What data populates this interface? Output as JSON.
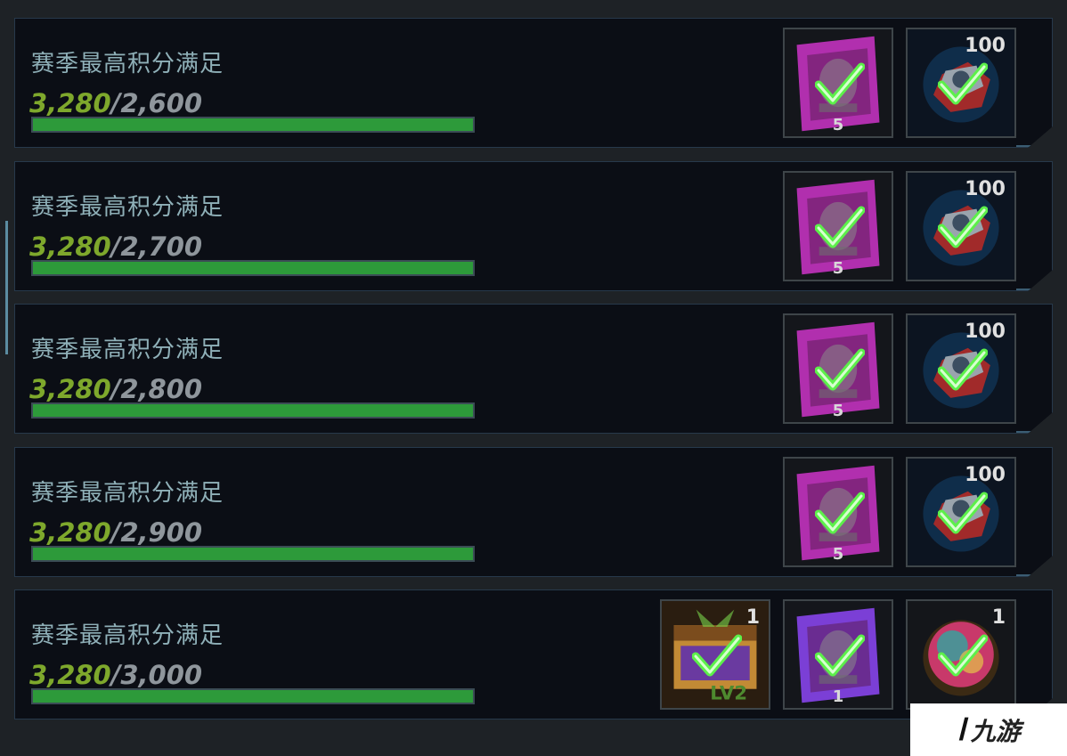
{
  "rows": [
    {
      "title": "赛季最高积分满足",
      "current": "3,280",
      "target": "/2,600",
      "progress": 1.0,
      "rewards": [
        {
          "icon": "magenta-card-icon",
          "qty": "5",
          "qty_pos": "bottom",
          "claimed": true
        },
        {
          "icon": "red-emblem-icon",
          "qty": "100",
          "qty_pos": "top",
          "claimed": true
        }
      ]
    },
    {
      "title": "赛季最高积分满足",
      "current": "3,280",
      "target": "/2,700",
      "progress": 1.0,
      "rewards": [
        {
          "icon": "magenta-card-icon",
          "qty": "5",
          "qty_pos": "bottom",
          "claimed": true
        },
        {
          "icon": "red-emblem-icon",
          "qty": "100",
          "qty_pos": "top",
          "claimed": true
        }
      ]
    },
    {
      "title": "赛季最高积分满足",
      "current": "3,280",
      "target": "/2,800",
      "progress": 1.0,
      "rewards": [
        {
          "icon": "magenta-card-icon",
          "qty": "5",
          "qty_pos": "bottom",
          "claimed": true
        },
        {
          "icon": "red-emblem-icon",
          "qty": "100",
          "qty_pos": "top",
          "claimed": true
        }
      ]
    },
    {
      "title": "赛季最高积分满足",
      "current": "3,280",
      "target": "/2,900",
      "progress": 1.0,
      "rewards": [
        {
          "icon": "magenta-card-icon",
          "qty": "5",
          "qty_pos": "bottom",
          "claimed": true
        },
        {
          "icon": "red-emblem-icon",
          "qty": "100",
          "qty_pos": "top",
          "claimed": true
        }
      ]
    },
    {
      "title": "赛季最高积分满足",
      "current": "3,280",
      "target": "/3,000",
      "progress": 1.0,
      "rewards": [
        {
          "icon": "gold-chest-lv2-icon",
          "qty": "1",
          "qty_pos": "top",
          "claimed": true
        },
        {
          "icon": "purple-card-icon",
          "qty": "1",
          "qty_pos": "bottom",
          "claimed": true
        },
        {
          "icon": "bottle-cap-badge-icon",
          "qty": "1",
          "qty_pos": "top",
          "claimed": true
        }
      ]
    }
  ],
  "colors": {
    "score_current": "#7ea82c",
    "progress_fill": "#2d9a3a",
    "check": "#5cf04a"
  },
  "watermark": {
    "mark": "ߊ",
    "text": "九游"
  }
}
